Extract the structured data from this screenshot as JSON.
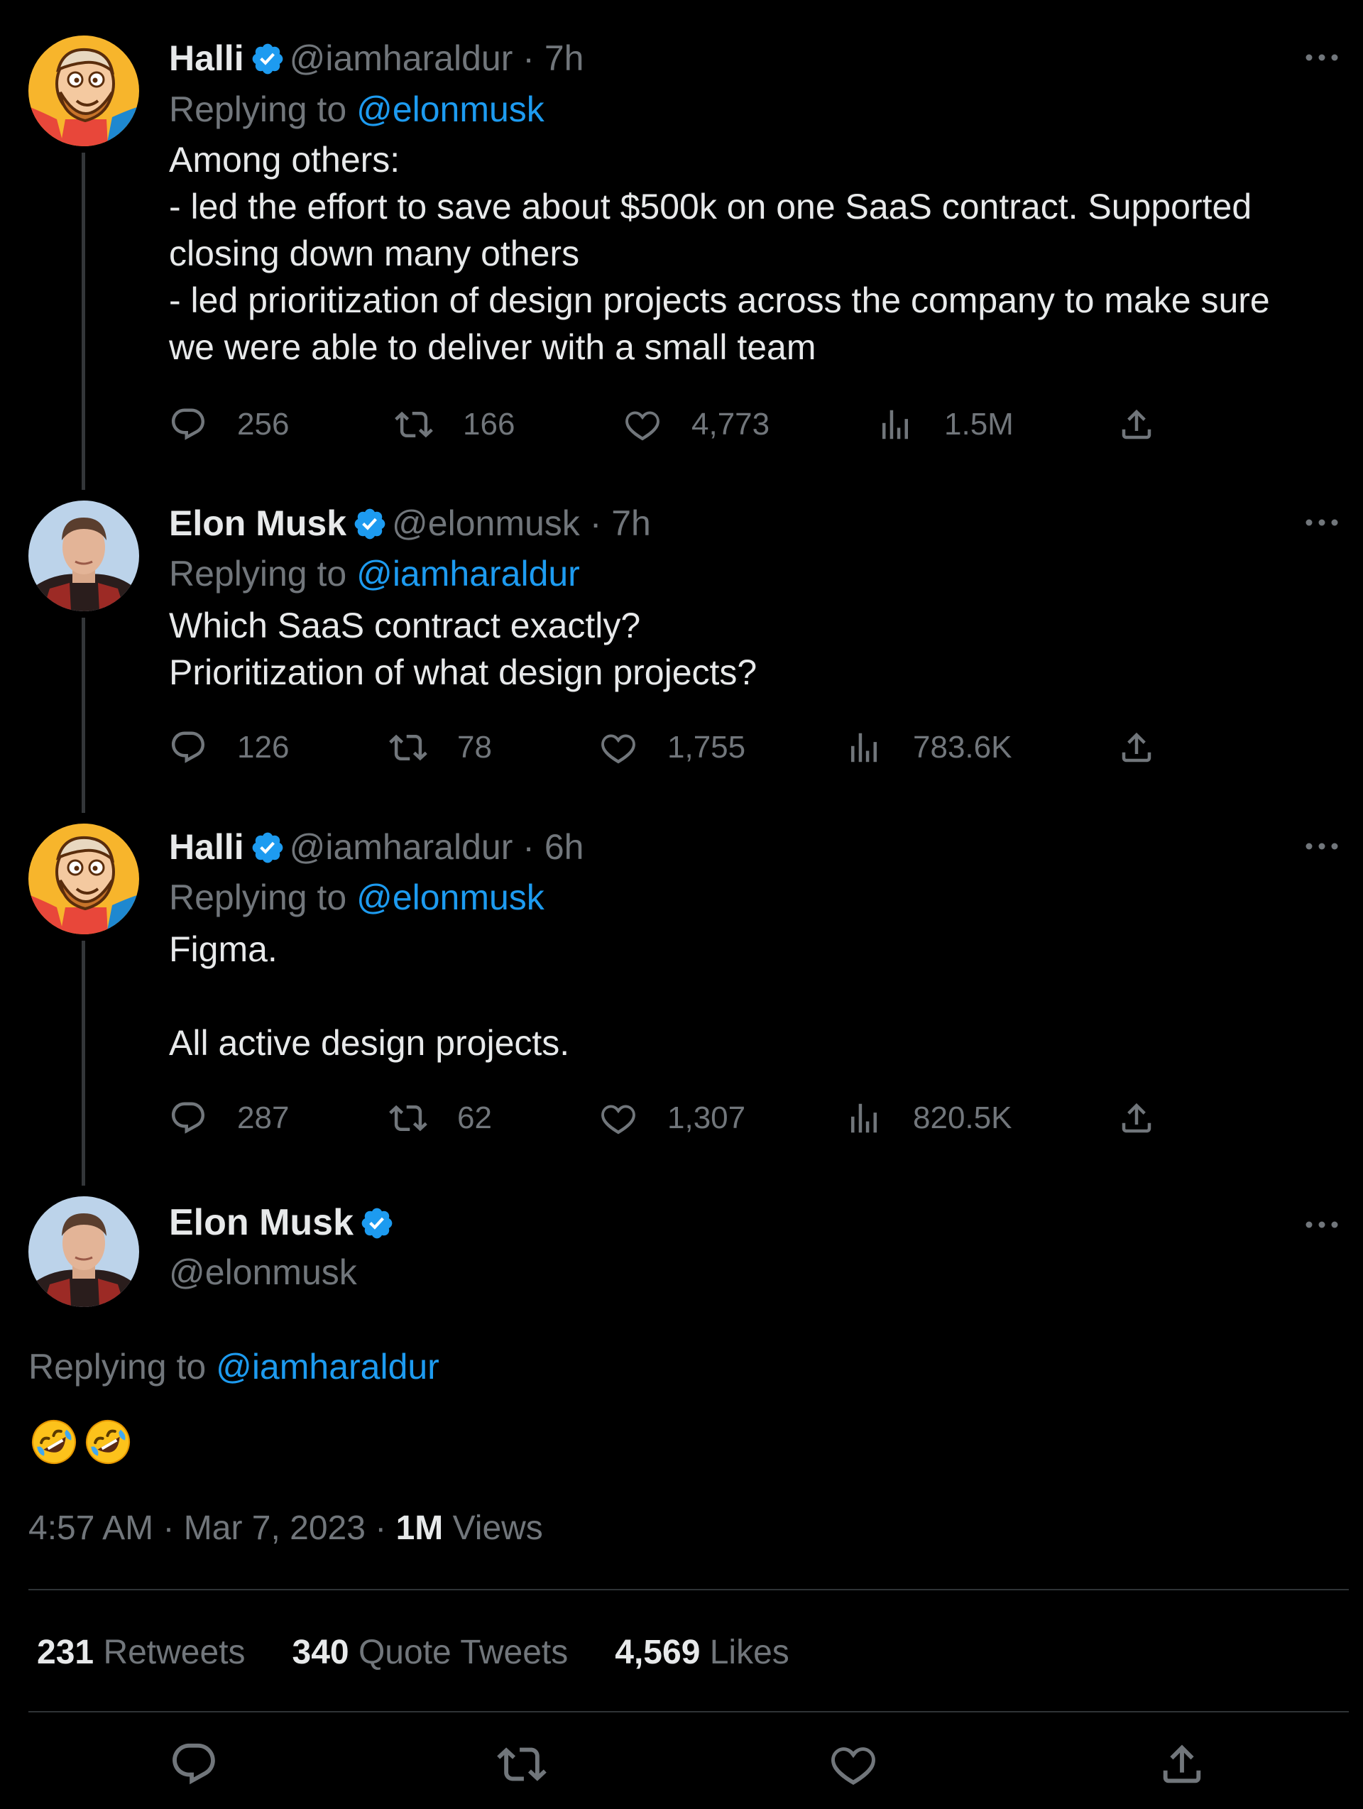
{
  "thread": [
    {
      "name": "Halli",
      "handle": "@iamharaldur",
      "time": "· 7h",
      "replying_label": "Replying to",
      "replying_to": "@elonmusk",
      "text": "Among others:\n- led the effort to save about $500k on one SaaS contract. Supported closing down many others\n- led prioritization of design projects across the company to make sure we were able to deliver with a small team",
      "replies": "256",
      "retweets": "166",
      "likes": "4,773",
      "views": "1.5M"
    },
    {
      "name": "Elon Musk",
      "handle": "@elonmusk",
      "time": "· 7h",
      "replying_label": "Replying to",
      "replying_to": "@iamharaldur",
      "text": "Which SaaS contract exactly?\nPrioritization of what design projects?",
      "replies": "126",
      "retweets": "78",
      "likes": "1,755",
      "views": "783.6K"
    },
    {
      "name": "Halli",
      "handle": "@iamharaldur",
      "time": "· 6h",
      "replying_label": "Replying to",
      "replying_to": "@elonmusk",
      "text": "Figma.\n\nAll active design projects.",
      "replies": "287",
      "retweets": "62",
      "likes": "1,307",
      "views": "820.5K"
    }
  ],
  "main_tweet": {
    "name": "Elon Musk",
    "handle": "@elonmusk",
    "replying_label": "Replying to",
    "replying_to": "@iamharaldur",
    "emoji_name": "rolling-on-floor-laughing",
    "time": "4:57 AM",
    "date": "· Mar 7, 2023 ·",
    "views_count": "1M",
    "views_label": "Views",
    "retweets_count": "231",
    "retweets_label": "Retweets",
    "quotes_count": "340",
    "quotes_label": "Quote Tweets",
    "likes_count": "4,569",
    "likes_label": "Likes"
  },
  "colors": {
    "background": "#000000",
    "text": "#e7e9ea",
    "secondary": "#71767b",
    "link": "#1d9bf0",
    "divider": "#2f3336"
  },
  "icons": [
    "reply-icon",
    "retweet-icon",
    "like-icon",
    "views-icon",
    "share-icon",
    "verified-badge-icon",
    "more-icon"
  ]
}
